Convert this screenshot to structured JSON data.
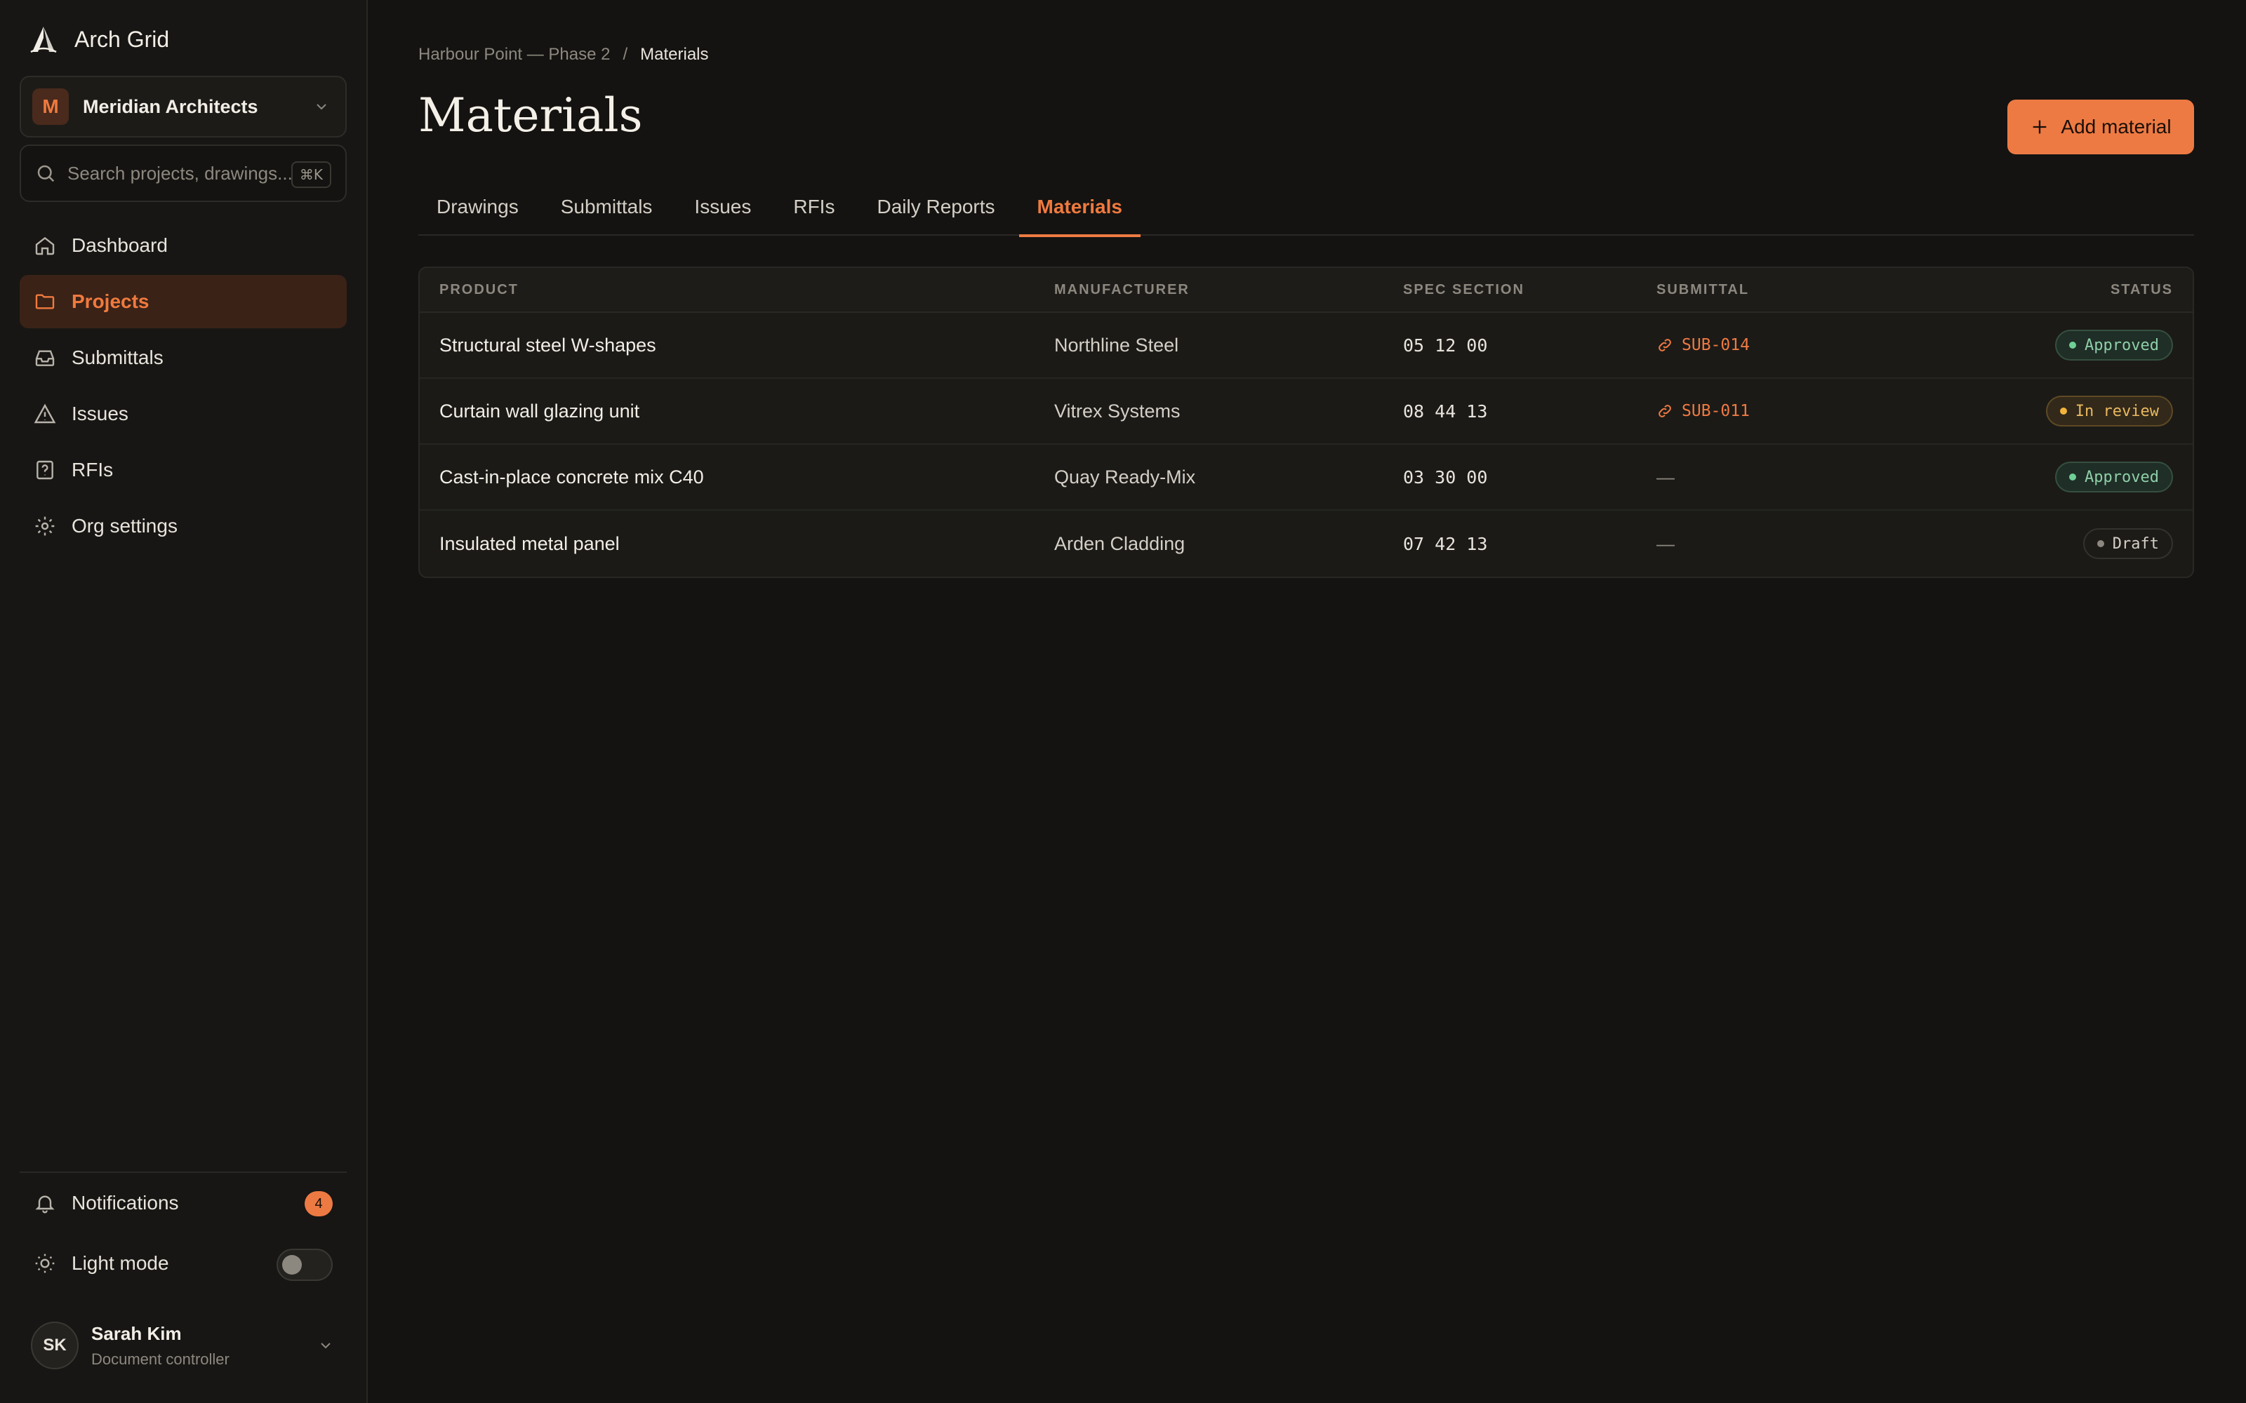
{
  "brand": {
    "name": "Arch Grid"
  },
  "org": {
    "initial": "M",
    "name": "Meridian Architects"
  },
  "search": {
    "placeholder": "Search projects, drawings...",
    "shortcut": "⌘K"
  },
  "nav": [
    {
      "label": "Dashboard",
      "icon": "home-icon"
    },
    {
      "label": "Projects",
      "icon": "folder-icon",
      "active": true
    },
    {
      "label": "Submittals",
      "icon": "inbox-icon"
    },
    {
      "label": "Issues",
      "icon": "warning-icon"
    },
    {
      "label": "RFIs",
      "icon": "help-icon"
    },
    {
      "label": "Org settings",
      "icon": "gear-icon"
    }
  ],
  "bottom": {
    "notifications_label": "Notifications",
    "notifications_count": "4",
    "light_mode_label": "Light mode",
    "light_mode_on": false
  },
  "user": {
    "initials": "SK",
    "name": "Sarah Kim",
    "role": "Document controller"
  },
  "breadcrumb": {
    "project": "Harbour Point — Phase 2",
    "separator": "/",
    "current": "Materials"
  },
  "page": {
    "title": "Materials",
    "add_label": "Add material"
  },
  "tabs": [
    {
      "label": "Drawings"
    },
    {
      "label": "Submittals"
    },
    {
      "label": "Issues"
    },
    {
      "label": "RFIs"
    },
    {
      "label": "Daily Reports"
    },
    {
      "label": "Materials",
      "active": true
    }
  ],
  "table": {
    "columns": [
      "PRODUCT",
      "MANUFACTURER",
      "SPEC SECTION",
      "SUBMITTAL",
      "STATUS"
    ],
    "rows": [
      {
        "product": "Structural steel W-shapes",
        "manufacturer": "Northline Steel",
        "spec": "05 12 00",
        "submittal": "SUB-014",
        "status": "Approved",
        "status_kind": "approved"
      },
      {
        "product": "Curtain wall glazing unit",
        "manufacturer": "Vitrex Systems",
        "spec": "08 44 13",
        "submittal": "SUB-011",
        "status": "In review",
        "status_kind": "review"
      },
      {
        "product": "Cast-in-place concrete mix C40",
        "manufacturer": "Quay Ready-Mix",
        "spec": "03 30 00",
        "submittal": "—",
        "status": "Approved",
        "status_kind": "approved"
      },
      {
        "product": "Insulated metal panel",
        "manufacturer": "Arden Cladding",
        "spec": "07 42 13",
        "submittal": "—",
        "status": "Draft",
        "status_kind": "draft"
      }
    ]
  },
  "colors": {
    "accent": "#ee7a43",
    "background": "#141311",
    "approved": "#6fcf97",
    "review": "#f2b53c"
  }
}
